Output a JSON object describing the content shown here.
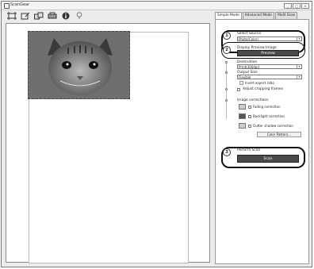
{
  "window": {
    "title": "ScanGear",
    "min": "_",
    "max": "□",
    "close": "×"
  },
  "tabs": [
    {
      "label": "Simple Mode"
    },
    {
      "label": "Advanced Mode"
    },
    {
      "label": "Multi Scan"
    }
  ],
  "steps": {
    "select_source": {
      "number": "1",
      "label": "Select Source",
      "value": "Photo(Color)"
    },
    "preview": {
      "number": "2",
      "label": "Display Preview Image",
      "button": "Preview"
    },
    "destination": {
      "label": "Destination",
      "value": "Print(300dpi)"
    },
    "output_size": {
      "label": "Output Size",
      "value": "Flexible",
      "invert_label": "Invert aspect ratio"
    },
    "crop": {
      "label": "Adjust cropping frames"
    },
    "image_corrections": {
      "label": "Image corrections",
      "fading": "Fading correction",
      "backlight": "Backlight correction",
      "gutter": "Gutter shadow correction",
      "color_pattern": "Color Pattern..."
    },
    "scan": {
      "number": "3",
      "label": "Perform Scan",
      "button": "Scan"
    }
  }
}
